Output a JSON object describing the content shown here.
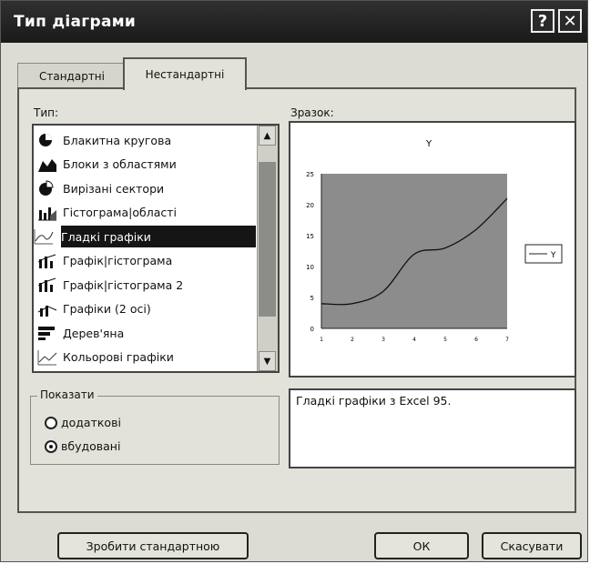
{
  "window": {
    "title": "Тип діаграми",
    "help_label": "?",
    "close_label": "✕"
  },
  "tabs": [
    {
      "label": "Стандартні"
    },
    {
      "label": "Нестандартні"
    }
  ],
  "type_label": "Тип:",
  "sample_label": "Зразок:",
  "chart_types": [
    {
      "label": "Блакитна кругова",
      "icon": "pie-icon"
    },
    {
      "label": "Блоки з областями",
      "icon": "area-blocks-icon"
    },
    {
      "label": "Вирізані сектори",
      "icon": "exploded-pie-icon"
    },
    {
      "label": "Гістограма|області",
      "icon": "column-area-icon"
    },
    {
      "label": "Гладкі графіки",
      "icon": "smooth-line-icon"
    },
    {
      "label": "Графік|гістограма",
      "icon": "line-column-icon"
    },
    {
      "label": "Графік|гістограма 2",
      "icon": "line-column-icon"
    },
    {
      "label": "Графіки (2 осі)",
      "icon": "two-axes-icon"
    },
    {
      "label": "Дерев'яна",
      "icon": "wood-icon"
    },
    {
      "label": "Кольорові графіки",
      "icon": "colored-lines-icon"
    }
  ],
  "selected_index": 4,
  "show": {
    "label": "Показати",
    "options": [
      {
        "label": "додаткові",
        "checked": false
      },
      {
        "label": "вбудовані",
        "checked": true
      }
    ]
  },
  "description": "Гладкі графіки з Excel 95.",
  "buttons": {
    "make_default": "Зробити стандартною",
    "ok": "ОК",
    "cancel": "Скасувати"
  },
  "chart_data": {
    "type": "line",
    "title": "Y",
    "x": [
      1,
      2,
      3,
      4,
      5,
      6,
      7
    ],
    "series": [
      {
        "name": "Y",
        "values": [
          4,
          4,
          6,
          12,
          13,
          16,
          21
        ]
      }
    ],
    "ylim": [
      0,
      25
    ],
    "yticks": [
      "0",
      "5",
      "10",
      "15",
      "20",
      "25"
    ],
    "xticks": [
      "1",
      "2",
      "3",
      "4",
      "5",
      "6",
      "7"
    ],
    "legend": "right",
    "plot_color": "#8c8c8c"
  }
}
